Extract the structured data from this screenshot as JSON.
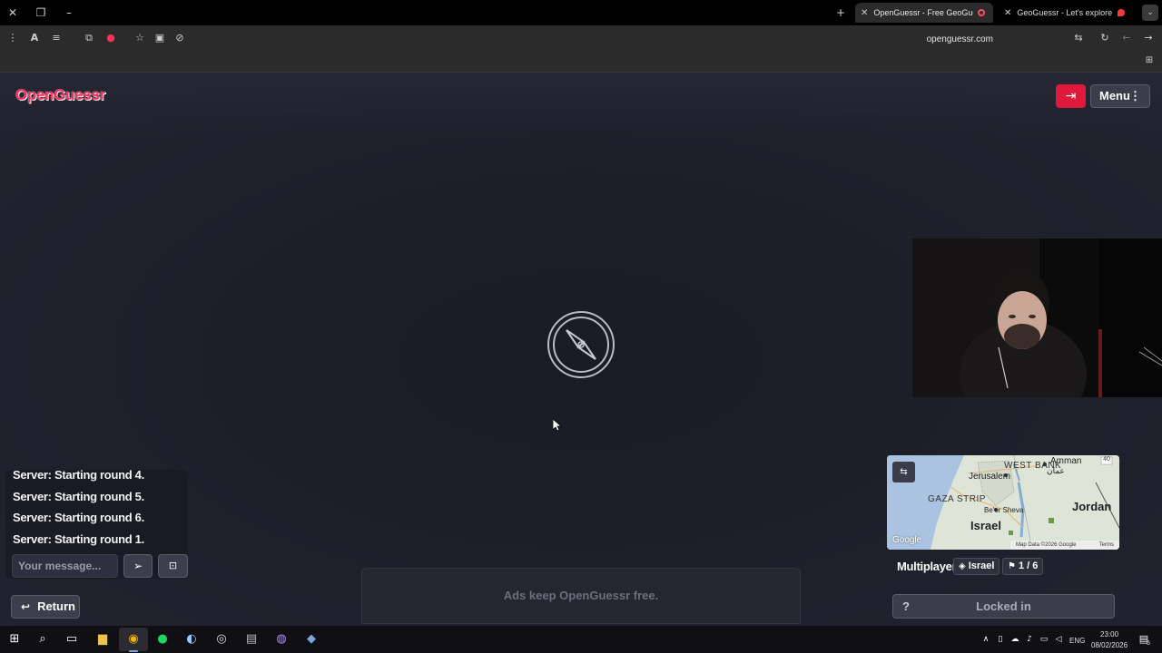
{
  "browser": {
    "tabs": [
      {
        "title": "OpenGuessr - Free GeoGue",
        "active": true
      },
      {
        "title": "GeoGuessr - Let's explore the w",
        "active": false
      }
    ],
    "address_bar": {
      "url": "openguessr.com"
    }
  },
  "app": {
    "logo": "OpenGuessr",
    "menu_label": "Menu",
    "chat": {
      "messages": [
        "Server: Starting round 4.",
        "Server: Starting round 5.",
        "Server: Starting round 6.",
        "Server: Starting round 1."
      ],
      "input_placeholder": "Your message..."
    },
    "return_label": "Return",
    "ads_text": "Ads keep OpenGuessr free.",
    "minimap": {
      "labels": {
        "west_bank": "WEST BANK",
        "amman": "Amman",
        "amman_ar": "عمان",
        "jerusalem": "Jerusalem",
        "gaza": "GAZA STRIP",
        "beer_sheva": "Be'er Sheva",
        "israel": "Israel",
        "jordan": "Jordan",
        "route": "40",
        "attribution": "Map Data ©2026 Google",
        "terms": "Terms",
        "google": "Google"
      }
    },
    "status": {
      "mode": "Multiplayer",
      "map_name": "Israel",
      "round": "1 / 6"
    },
    "locked_label": "Locked in",
    "help_label": "?"
  },
  "taskbar": {
    "time": "23:00",
    "date": "08/02/2026",
    "language": "ENG",
    "notifications": "5"
  },
  "colors": {
    "brand": "#ff2f5b",
    "exit_button": "#e0183c",
    "page_bg": "#1c1e28"
  }
}
